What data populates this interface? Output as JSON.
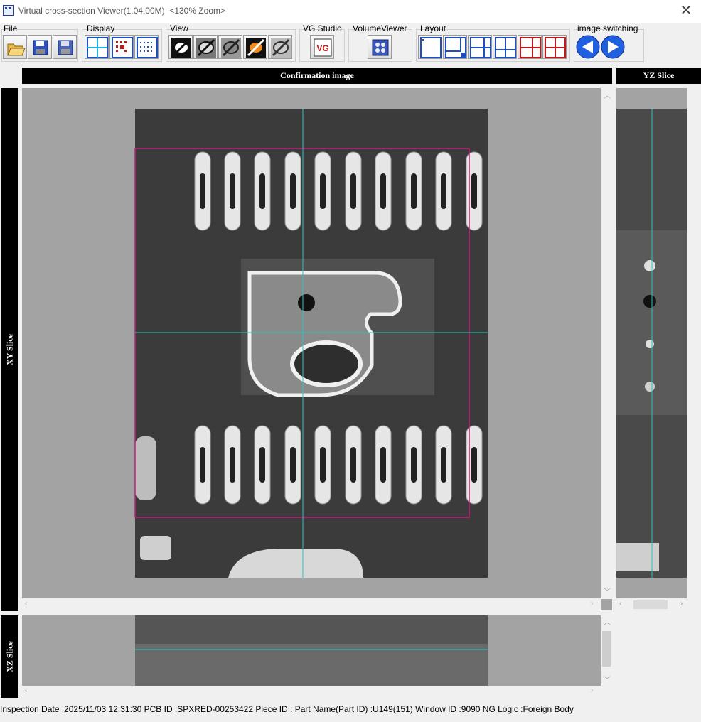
{
  "window": {
    "title": "Virtual cross-section Viewer(1.04.00M)",
    "zoom": "<130% Zoom>",
    "close_glyph": "✕"
  },
  "toolbar": {
    "groups": {
      "file": "File",
      "display": "Display",
      "view": "View",
      "vgstudio": "VG Studio",
      "volumeviewer": "VolumeViewer",
      "layout": "Layout",
      "image_switching": "image switching"
    },
    "vg_icon_text": "VG"
  },
  "panels": {
    "confirmation": "Confirmation image",
    "yz": "YZ Slice",
    "xy": "XY Slice",
    "xz": "XZ Slice"
  },
  "status": {
    "text": "Inspection Date :2025/11/03 12:31:30  PCB ID :SPXRED-00253422  Piece ID :  Part Name(Part ID) :U149(151)  Window ID :9090  NG Logic :Foreign Body"
  },
  "colors": {
    "crosshair": "#26c6c6",
    "roi": "#c0207a",
    "panel_bg": "#a3a3a3",
    "header_bg": "#000000",
    "icon_blue": "#1f4fbf",
    "icon_red": "#c01818"
  },
  "icons": [
    "app-icon",
    "open-folder-icon",
    "save-icon",
    "save-as-icon",
    "crosshair-icon",
    "grid-display-icon",
    "dot-grid-icon",
    "view-mode-icons",
    "vg-studio-icon",
    "volume-viewer-icon",
    "layout-icons",
    "prev-arrow-icon",
    "next-arrow-icon",
    "close-icon"
  ]
}
